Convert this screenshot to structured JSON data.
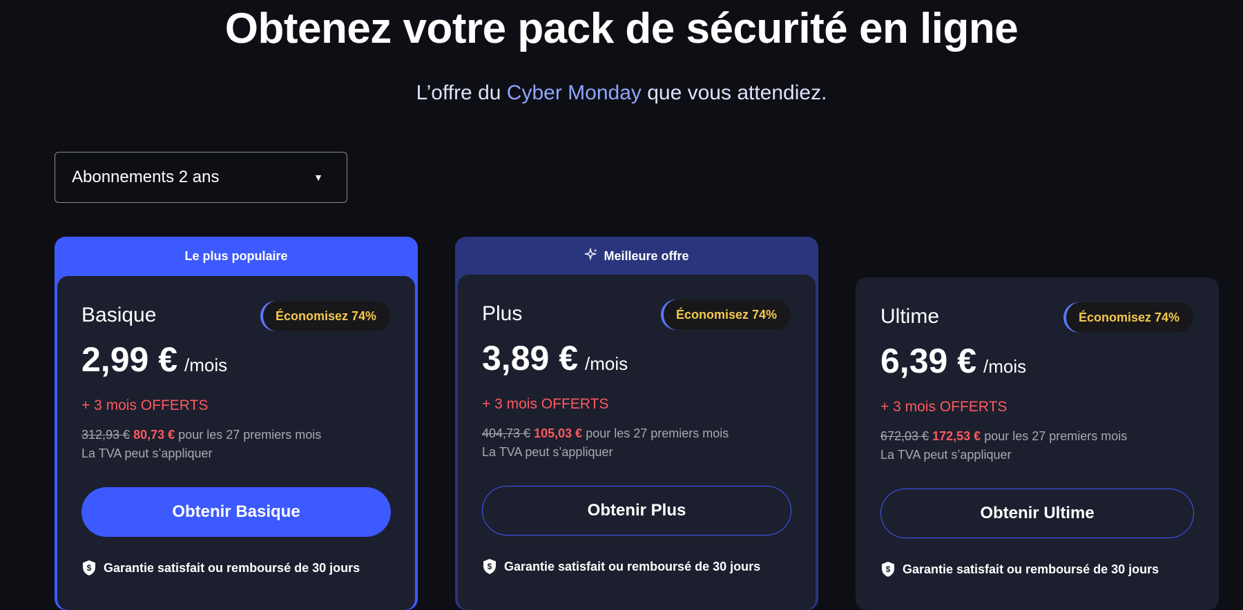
{
  "header": {
    "title": "Obtenez votre pack de sécurité en ligne",
    "subtitle_before": "L’offre du",
    "subtitle_accent": "Cyber Monday",
    "subtitle_after": "que vous attendiez."
  },
  "billing_select": {
    "value": "Abonnements 2 ans",
    "caret_icon": "triangle-down-icon"
  },
  "plans": [
    {
      "banner": "Le plus populaire",
      "name": "Basique",
      "badge": "Économisez 74%",
      "price": "2,99 €",
      "per": "/mois",
      "offer": "+ 3 mois OFFERTS",
      "old_total": "312,93 €",
      "new_total": "80,73 €",
      "period_text": "pour les 27 premiers mois",
      "vat": "La TVA peut s’appliquer",
      "cta": "Obtenir Basique",
      "guarantee": "Garantie satisfait ou remboursé de 30 jours"
    },
    {
      "banner": "Meilleure offre",
      "banner_icon": "sparkle-icon",
      "name": "Plus",
      "badge": "Économisez 74%",
      "price": "3,89 €",
      "per": "/mois",
      "offer": "+ 3 mois OFFERTS",
      "old_total": "404,73 €",
      "new_total": "105,03 €",
      "period_text": "pour les 27 premiers mois",
      "vat": "La TVA peut s’appliquer",
      "cta": "Obtenir Plus",
      "guarantee": "Garantie satisfait ou remboursé de 30 jours"
    },
    {
      "name": "Ultime",
      "badge": "Économisez 74%",
      "price": "6,39 €",
      "per": "/mois",
      "offer": "+ 3 mois OFFERTS",
      "old_total": "672,03 €",
      "new_total": "172,53 €",
      "period_text": "pour les 27 premiers mois",
      "vat": "La TVA peut s’appliquer",
      "cta": "Obtenir Ultime",
      "guarantee": "Garantie satisfait ou remboursé de 30 jours"
    }
  ],
  "colors": {
    "background": "#0e0f14",
    "card": "#1c1f2e",
    "primary": "#3d5afe",
    "banner_navy": "#29357d",
    "offer_red": "#ff5a5f",
    "badge_gold": "#f5c84b"
  }
}
